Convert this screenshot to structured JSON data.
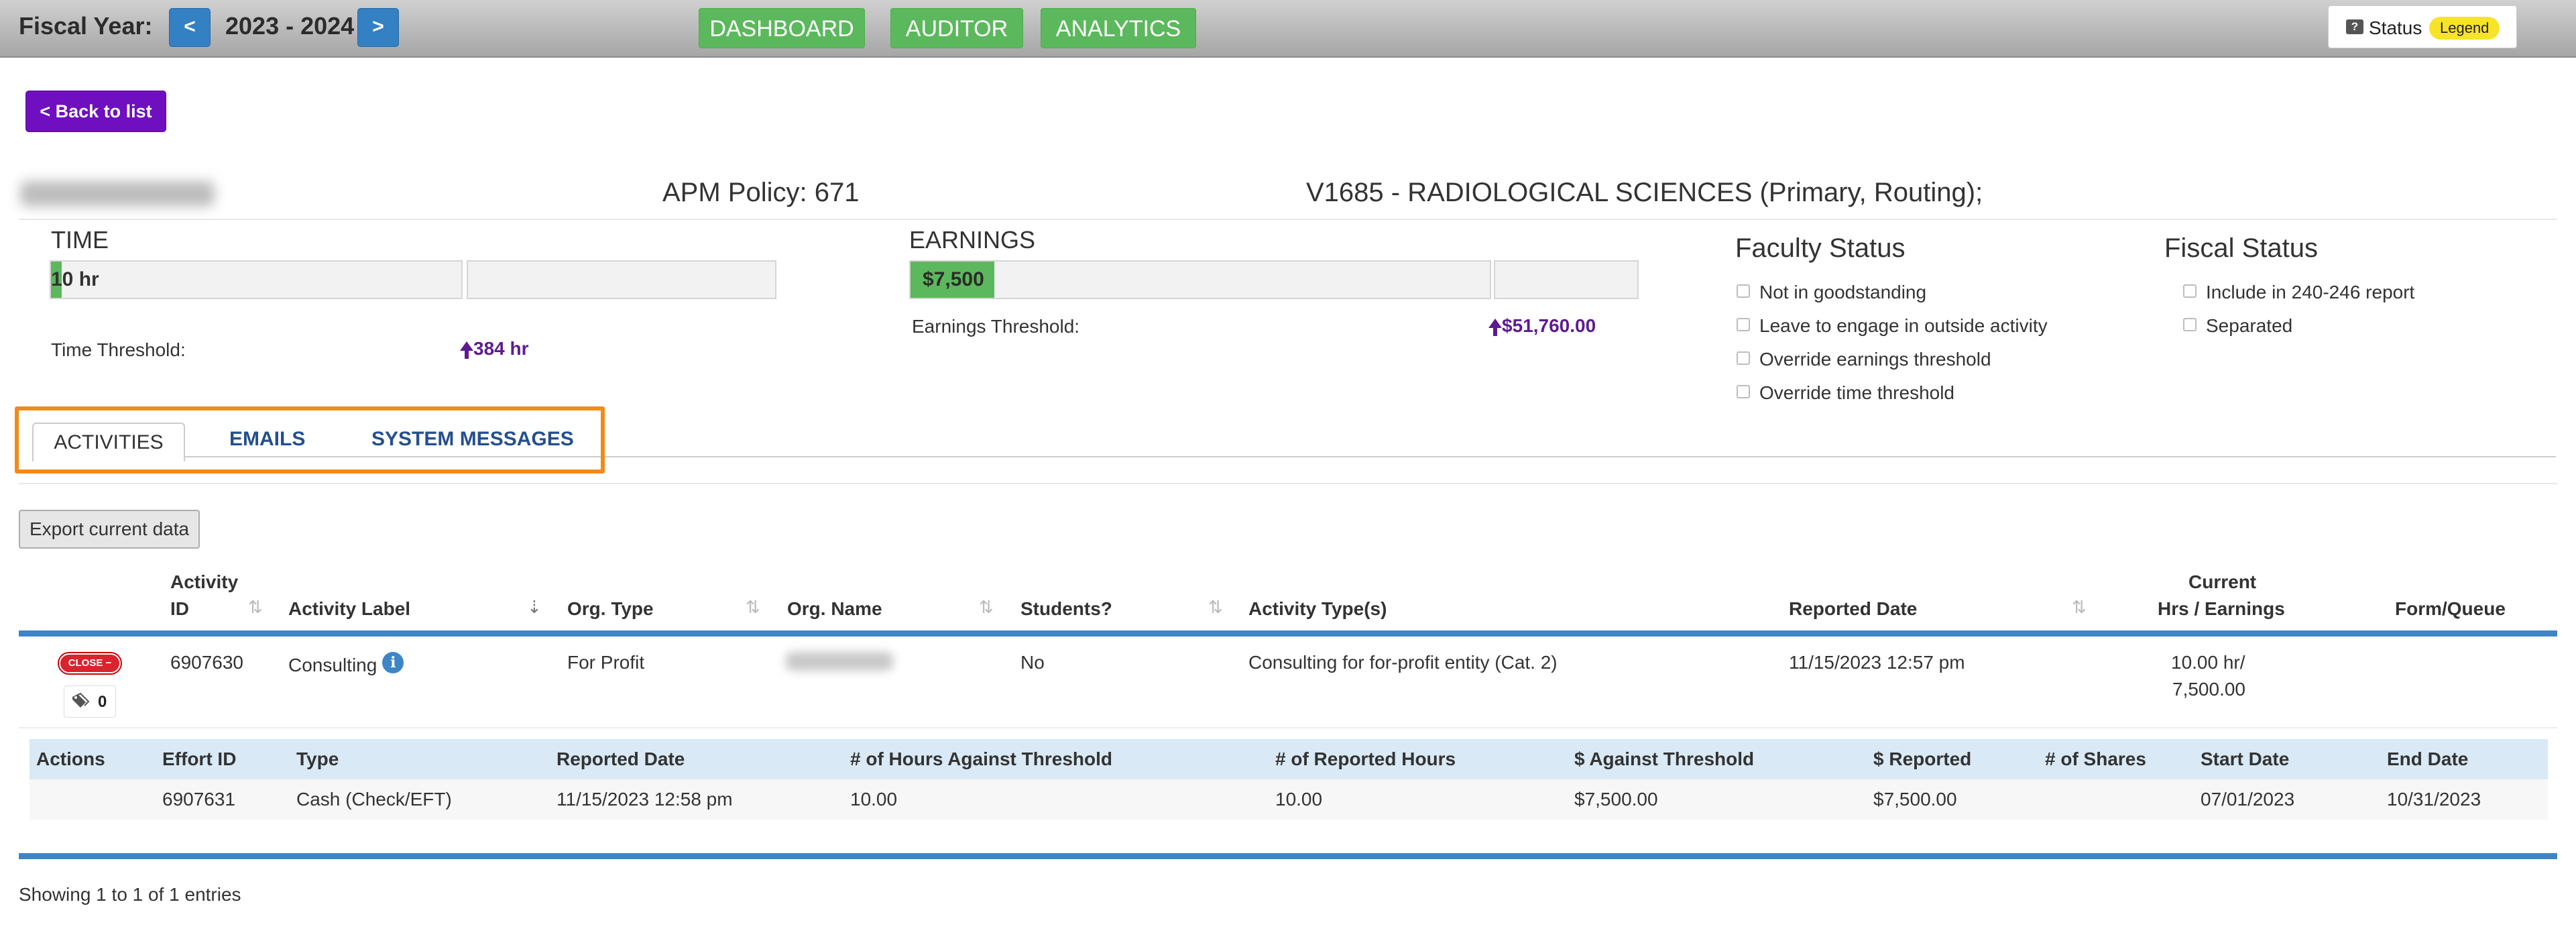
{
  "topbar": {
    "fiscal_year_label": "Fiscal Year:",
    "prev_label": "<",
    "fiscal_year_value": "2023 - 2024",
    "next_label": ">",
    "nav": [
      "DASHBOARD",
      "AUDITOR",
      "ANALYTICS"
    ],
    "status_icon": "?",
    "status_label": "Status",
    "legend_label": "Legend"
  },
  "back_label": "< Back to list",
  "header": {
    "apm_policy": "APM Policy: 671",
    "department": "V1685 - RADIOLOGICAL SCIENCES (Primary, Routing);"
  },
  "time": {
    "title": "TIME",
    "bar_label": "10 hr",
    "threshold_label": "Time Threshold:",
    "threshold_value": "384 hr",
    "fill_fraction": 0.026
  },
  "earnings": {
    "title": "EARNINGS",
    "bar_label": "$7,500",
    "threshold_label": "Earnings Threshold:",
    "threshold_value": "$51,760.00",
    "fill_fraction": 0.145
  },
  "faculty_status": {
    "title": "Faculty Status",
    "items": [
      "Not in goodstanding",
      "Leave to engage in outside activity",
      "Override earnings threshold",
      "Override time threshold"
    ]
  },
  "fiscal_status": {
    "title": "Fiscal Status",
    "items": [
      "Include in 240-246 report",
      "Separated"
    ]
  },
  "tabs": [
    "ACTIVITIES",
    "EMAILS",
    "SYSTEM MESSAGES"
  ],
  "export_label": "Export current data",
  "table": {
    "headers": {
      "activity_id_1": "Activity",
      "activity_id_2": "ID",
      "activity_label": "Activity Label",
      "org_type": "Org. Type",
      "org_name": "Org. Name",
      "students": "Students?",
      "activity_types": "Activity Type(s)",
      "reported_date": "Reported Date",
      "current_1": "Current",
      "current_2": "Hrs / Earnings",
      "form_queue": "Form/Queue"
    },
    "row": {
      "close_label": "CLOSE −",
      "tag_count": "0",
      "activity_id": "6907630",
      "activity_label": "Consulting",
      "info_icon": "i",
      "org_type": "For Profit",
      "students": "No",
      "activity_types": "Consulting for for-profit entity (Cat. 2)",
      "reported_date": "11/15/2023 12:57 pm",
      "current_1": "10.00 hr/",
      "current_2": "7,500.00"
    }
  },
  "effort": {
    "headers": [
      "Actions",
      "Effort ID",
      "Type",
      "Reported Date",
      "# of Hours Against Threshold",
      "# of Reported Hours",
      "$ Against Threshold",
      "$ Reported",
      "# of Shares",
      "Start Date",
      "End Date"
    ],
    "row": [
      "",
      "6907631",
      "Cash (Check/EFT)",
      "11/15/2023 12:58 pm",
      "10.00",
      "10.00",
      "$7,500.00",
      "$7,500.00",
      "",
      "07/01/2023",
      "10/31/2023"
    ]
  },
  "showing": "Showing 1 to 1 of 1 entries",
  "colors": {
    "accent_blue": "#3d85c6",
    "nav_green": "#5cb85c",
    "back_purple": "#6f0fbf",
    "highlight_orange": "#f28a1a",
    "threshold_purple": "#5e1b8f"
  }
}
